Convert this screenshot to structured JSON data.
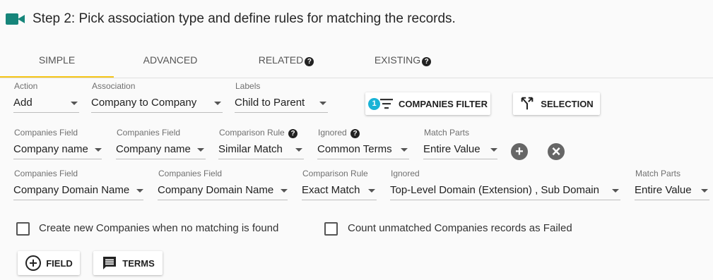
{
  "header": {
    "title": "Step 2: Pick association type and define rules for matching the records.",
    "icon": "video-camera-icon",
    "accent": "#16857a"
  },
  "tabs": [
    {
      "label": "SIMPLE",
      "active": true
    },
    {
      "label": "ADVANCED"
    },
    {
      "label": "RELATED",
      "help": "?"
    },
    {
      "label": "EXISTING",
      "help": "?"
    }
  ],
  "row1": {
    "action": {
      "label": "Action",
      "value": "Add"
    },
    "association": {
      "label": "Association",
      "value": "Company to Company"
    },
    "labels": {
      "label": "Labels",
      "value": "Child to Parent"
    },
    "filter_button": {
      "label": "COMPANIES FILTER",
      "badge": "1"
    },
    "selection_button": {
      "label": "SELECTION"
    }
  },
  "rule1": {
    "field_a": {
      "label": "Companies Field",
      "value": "Company name"
    },
    "field_b": {
      "label": "Companies Field",
      "value": "Company name"
    },
    "comparison": {
      "label": "Comparison Rule",
      "value": "Similar Match",
      "help": "?"
    },
    "ignored": {
      "label": "Ignored",
      "value": "Common Terms",
      "help": "?"
    },
    "match_parts": {
      "label": "Match Parts",
      "value": "Entire Value"
    },
    "add": "+",
    "remove": "×"
  },
  "rule2": {
    "field_a": {
      "label": "Companies Field",
      "value": "Company Domain Name"
    },
    "field_b": {
      "label": "Companies Field",
      "value": "Company Domain Name"
    },
    "comparison": {
      "label": "Comparison Rule",
      "value": "Exact Match"
    },
    "ignored": {
      "label": "Ignored",
      "value": "Top-Level Domain (Extension) , Sub Domain"
    },
    "match_parts": {
      "label": "Match Parts",
      "value": "Entire Value"
    }
  },
  "options": {
    "create_new": {
      "label": "Create new Companies when no matching is found",
      "checked": false
    },
    "count_unmatched": {
      "label": "Count unmatched Companies records as Failed",
      "checked": false
    }
  },
  "bottom_buttons": {
    "field": "FIELD",
    "terms": "TERMS"
  }
}
